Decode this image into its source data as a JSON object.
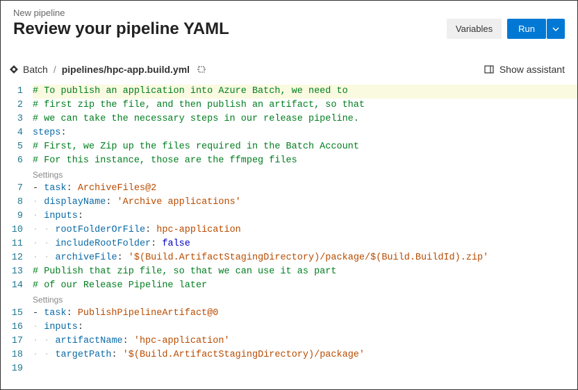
{
  "header": {
    "crumb": "New pipeline",
    "title": "Review your pipeline YAML",
    "variables_btn": "Variables",
    "run_btn": "Run"
  },
  "subbar": {
    "repo": "Batch",
    "sep": "/",
    "file": "pipelines/hpc-app.build.yml",
    "show_assistant": "Show assistant"
  },
  "settings_label": "Settings",
  "code": {
    "l1": "# To publish an application into Azure Batch, we need to",
    "l2": "# first zip the file, and then publish an artifact, so that",
    "l3": "# we can take the necessary steps in our release pipeline.",
    "l4k": "steps",
    "l5": "# First, we Zip up the files required in the Batch Account",
    "l6": "# For this instance, those are the ffmpeg files",
    "l7_task": "task",
    "l7_val": "ArchiveFiles@2",
    "l8_key": "displayName",
    "l8_val": "'Archive applications'",
    "l9_key": "inputs",
    "l10_key": "rootFolderOrFile",
    "l10_val": "hpc-application",
    "l11_key": "includeRootFolder",
    "l11_val": "false",
    "l12_key": "archiveFile",
    "l12_val": "'$(Build.ArtifactStagingDirectory)/package/$(Build.BuildId).zip'",
    "l13": "# Publish that zip file, so that we can use it as part",
    "l14": "# of our Release Pipeline later",
    "l15_task": "task",
    "l15_val": "PublishPipelineArtifact@0",
    "l16_key": "inputs",
    "l17_key": "artifactName",
    "l17_val": "'hpc-application'",
    "l18_key": "targetPath",
    "l18_val": "'$(Build.ArtifactStagingDirectory)/package'"
  },
  "line_numbers": [
    "1",
    "2",
    "3",
    "4",
    "5",
    "6",
    "7",
    "8",
    "9",
    "10",
    "11",
    "12",
    "13",
    "14",
    "15",
    "16",
    "17",
    "18",
    "19"
  ]
}
